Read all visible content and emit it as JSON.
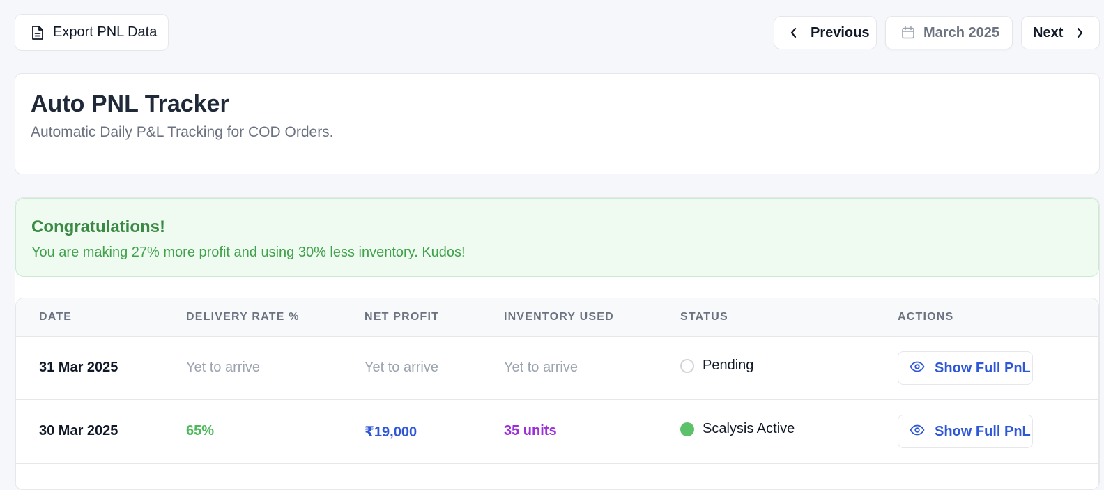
{
  "toolbar": {
    "export_label": "Export PNL Data",
    "previous_label": "Previous",
    "month_label": "March 2025",
    "next_label": "Next"
  },
  "header": {
    "title": "Auto PNL Tracker",
    "subtitle": "Automatic Daily P&L Tracking for COD Orders."
  },
  "banner": {
    "title": "Congratulations!",
    "message": "You are making 27% more profit and using 30% less inventory. Kudos!"
  },
  "table": {
    "columns": [
      "DATE",
      "DELIVERY RATE %",
      "NET PROFIT",
      "INVENTORY USED",
      "STATUS",
      "ACTIONS"
    ],
    "rows": [
      {
        "date": "31 Mar 2025",
        "delivery_rate": "Yet to arrive",
        "net_profit": "Yet to arrive",
        "inventory": "Yet to arrive",
        "status": "Pending",
        "action": "Show Full PnL"
      },
      {
        "date": "30 Mar 2025",
        "delivery_rate": "65%",
        "net_profit": "₹19,000",
        "inventory": "35 units",
        "status": "Scalysis Active",
        "action": "Show Full PnL"
      }
    ]
  },
  "colors": {
    "success_green": "#4cb85a",
    "profit_blue": "#2e57d6",
    "inventory_purple": "#9b2fd8",
    "pending_border": "#d1d5db"
  },
  "icons": {
    "export": "document-icon",
    "previous": "chevron-left-icon",
    "month": "calendar-icon",
    "next": "chevron-right-icon",
    "action": "eye-icon"
  }
}
